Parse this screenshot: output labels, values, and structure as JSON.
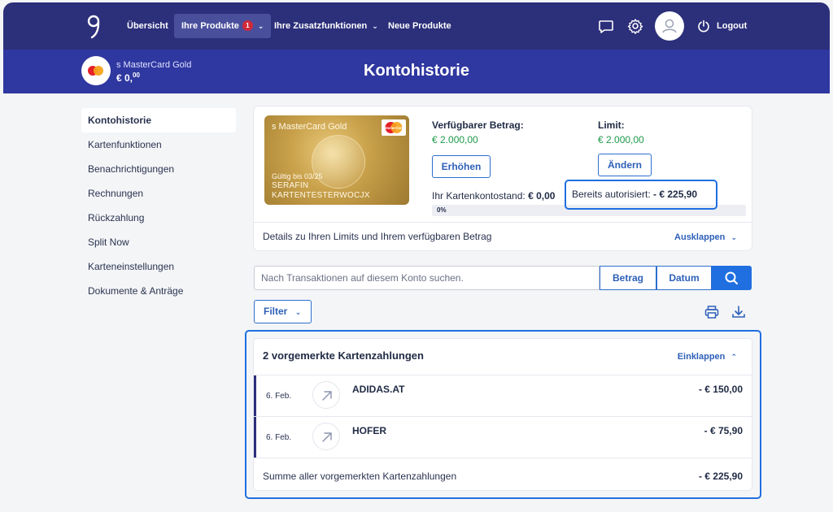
{
  "nav": {
    "overview": "Übersicht",
    "products": "Ihre Produkte",
    "products_badge": "1",
    "extras": "Ihre Zusatzfunktionen",
    "new_products": "Neue Produkte",
    "logout": "Logout"
  },
  "header": {
    "card_name": "s MasterCard Gold",
    "card_balance_main": "€ 0,",
    "card_balance_cents": "00",
    "title": "Kontohistorie"
  },
  "sidebar": {
    "items": [
      {
        "label": "Kontohistorie"
      },
      {
        "label": "Kartenfunktionen"
      },
      {
        "label": "Benachrichtigungen"
      },
      {
        "label": "Rechnungen"
      },
      {
        "label": "Rückzahlung"
      },
      {
        "label": "Split Now"
      },
      {
        "label": "Karteneinstellungen"
      },
      {
        "label": "Dokumente & Anträge"
      }
    ]
  },
  "card": {
    "name": "s MasterCard Gold",
    "logo_text": "MasterCard",
    "valid_until": "Gültig bis 03/25",
    "holder_line1": "SERAFIN",
    "holder_line2": "KARTENTESTERWOCJX"
  },
  "account": {
    "available_label": "Verfügbarer Betrag:",
    "available_value": "€ 2.000,00",
    "increase_button": "Erhöhen",
    "limit_label": "Limit:",
    "limit_value": "€ 2.000,00",
    "change_button": "Ändern",
    "balance_label": "Ihr Kartenkontostand:",
    "balance_value": "€ 0,00",
    "authorized_label": "Bereits autorisiert:",
    "authorized_value": "- € 225,90",
    "progress_text": "0%",
    "progress_fraction": 0.0,
    "details_text": "Details zu Ihren Limits und Ihrem verfügbaren Betrag",
    "expand_label": "Ausklappen"
  },
  "search": {
    "placeholder": "Nach Transaktionen auf diesem Konto suchen.",
    "amount_button": "Betrag",
    "date_button": "Datum",
    "filter_button": "Filter"
  },
  "pending": {
    "title": "2 vorgemerkte Kartenzahlungen",
    "collapse_label": "Einklappen",
    "transactions": [
      {
        "date": "6. Feb.",
        "merchant": "ADIDAS.AT",
        "amount": "- € 150,00"
      },
      {
        "date": "6. Feb.",
        "merchant": "HOFER",
        "amount": "- € 75,90"
      }
    ],
    "sum_label": "Summe aller vorgemerkten Kartenzahlungen",
    "sum_amount": "- € 225,90"
  },
  "colors": {
    "nav_bg": "#2c2f7a",
    "band_bg": "#2f37a0",
    "accent": "#1f6fe0",
    "positive": "#1d9a4a"
  }
}
